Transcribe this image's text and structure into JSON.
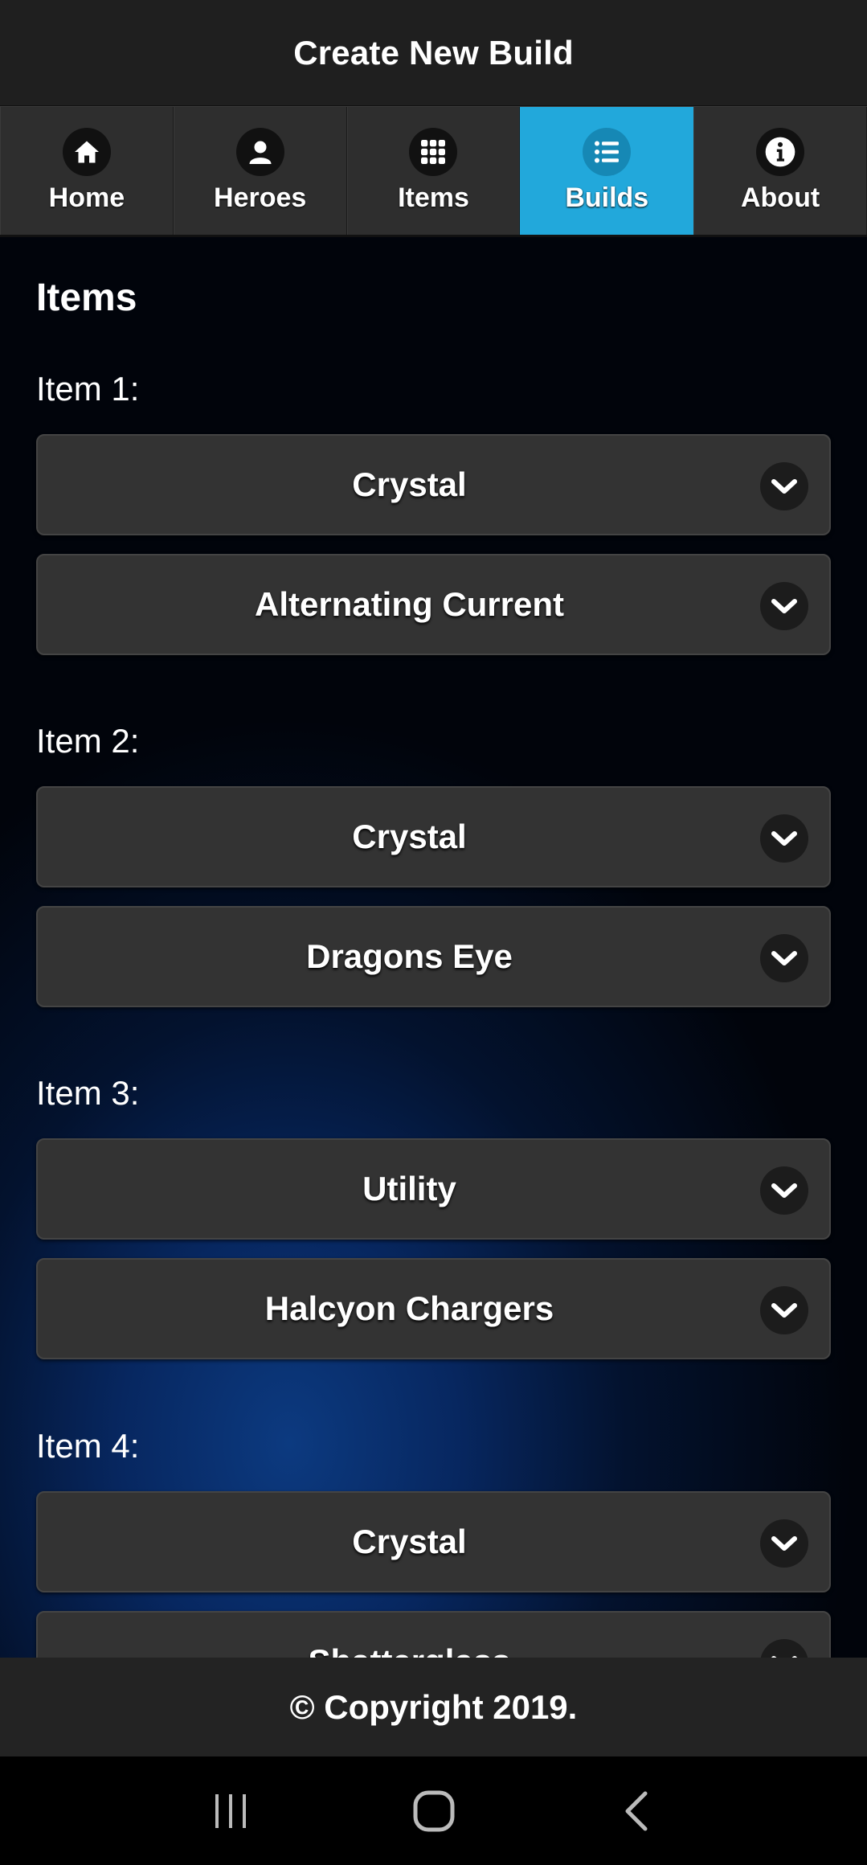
{
  "header": {
    "title": "Create New Build"
  },
  "nav": {
    "items": [
      {
        "label": "Home",
        "icon": "home-icon"
      },
      {
        "label": "Heroes",
        "icon": "user-icon"
      },
      {
        "label": "Items",
        "icon": "grid-icon"
      },
      {
        "label": "Builds",
        "icon": "list-icon",
        "active": true
      },
      {
        "label": "About",
        "icon": "info-icon"
      }
    ],
    "active_color": "#22a8db"
  },
  "main": {
    "title": "Items",
    "items": [
      {
        "label": "Item 1:",
        "category": "Crystal",
        "item": "Alternating Current"
      },
      {
        "label": "Item 2:",
        "category": "Crystal",
        "item": "Dragons Eye"
      },
      {
        "label": "Item 3:",
        "category": "Utility",
        "item": "Halcyon Chargers"
      },
      {
        "label": "Item 4:",
        "category": "Crystal",
        "item": "Shatterglass"
      }
    ]
  },
  "footer": {
    "text": "© Copyright 2019."
  },
  "system_nav": {
    "buttons": [
      "recent-apps-icon",
      "home-circle-icon",
      "back-icon"
    ]
  }
}
